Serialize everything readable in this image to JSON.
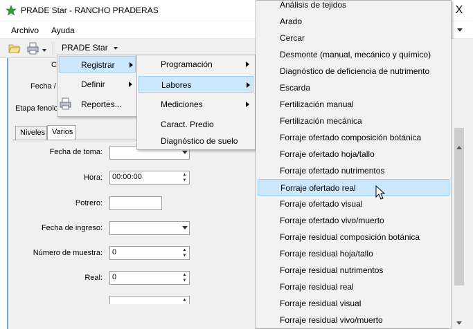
{
  "window": {
    "title": "PRADE Star - RANCHO PRADERAS",
    "close_glyph": "X"
  },
  "menubar": {
    "items": [
      "Archivo",
      "Ayuda"
    ]
  },
  "toolbar": {
    "prade_menu": "PRADE Star",
    "icons": [
      "open-folder-icon",
      "printer-icon"
    ]
  },
  "form_background": {
    "partial_label_c": "C",
    "partial_label_fecha": "Fecha /",
    "partial_label_etapa": "Etapa fenolo"
  },
  "tabs": [
    "Niveles",
    "Varios"
  ],
  "form": {
    "fecha_toma": {
      "label": "Fecha de toma:",
      "value": ""
    },
    "hora": {
      "label": "Hora:",
      "value": "00:00:00"
    },
    "potrero": {
      "label": "Potrero:",
      "value": ""
    },
    "fecha_ingreso": {
      "label": "Fecha de ingreso:",
      "value": ""
    },
    "numero_muestra": {
      "label": "Número de muestra:",
      "value": "0"
    },
    "real": {
      "label": "Real:",
      "value": "0"
    }
  },
  "menu_prade": {
    "items": [
      "Registrar",
      "Definir",
      "Reportes..."
    ]
  },
  "menu_registrar": {
    "items": [
      "Programación",
      "Labores",
      "Mediciones",
      "Caract. Predio",
      "Diagnóstico de suelo"
    ]
  },
  "menu_labores": {
    "items": [
      "Análisis de tejidos",
      "Arado",
      "Cercar",
      "Desmonte (manual, mecánico y químico)",
      "Diagnóstico de deficiencia de nutrimento",
      "Escarda",
      "Fertilización manual",
      "Fertilización mecánica",
      "Forraje ofertado composición botánica",
      "Forraje ofertado hoja/tallo",
      "Forraje ofertado nutrimentos",
      "Forraje ofertado real",
      "Forraje ofertado visual",
      "Forraje ofertado vivo/muerto",
      "Forraje residual composición botánica",
      "Forraje residual hoja/tallo",
      "Forraje residual nutrimentos",
      "Forraje residual real",
      "Forraje residual visual",
      "Forraje residual vivo/muerto"
    ],
    "highlighted": "Forraje ofertado real"
  },
  "colors": {
    "highlight": "#cce8ff",
    "highlight_border": "#99d1ff",
    "app_icon": "#2e9e3e"
  }
}
